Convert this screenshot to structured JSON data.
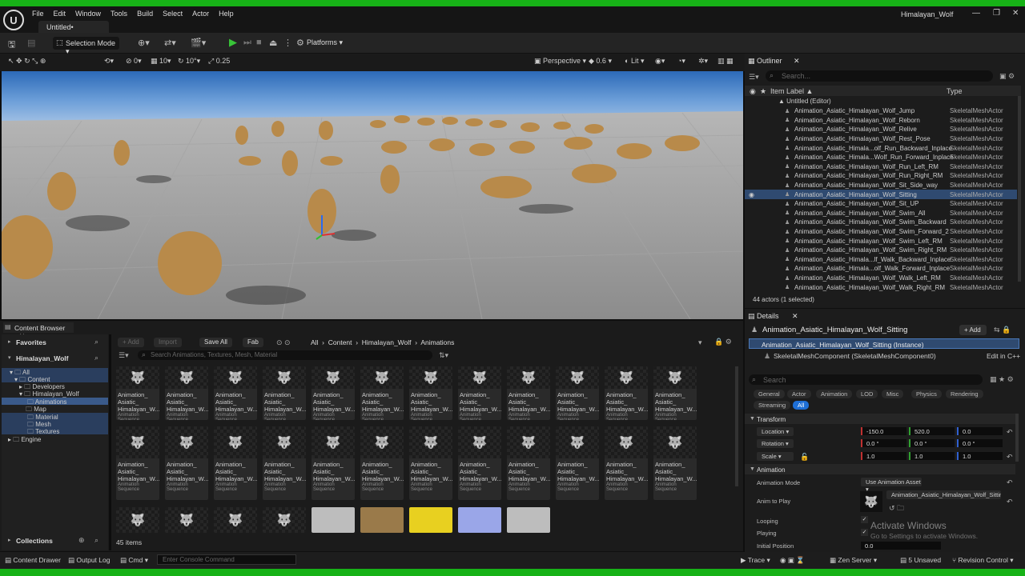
{
  "menu": [
    "File",
    "Edit",
    "Window",
    "Tools",
    "Build",
    "Select",
    "Actor",
    "Help"
  ],
  "document_tab": "Untitled•",
  "window_title": "Himalayan_Wolf",
  "toolbar": {
    "selection_mode": "Selection Mode",
    "platforms": "Platforms"
  },
  "viewport_bar": {
    "snap_translate": "0",
    "snap_grid": "10",
    "snap_rotate": "10°",
    "snap_scale": "0.25",
    "view_mode": "Perspective",
    "fov": "0.6",
    "lit": "Lit"
  },
  "outliner": {
    "tab": "Outliner",
    "search_placeholder": "Search...",
    "col_label": "Item Label ▲",
    "col_type": "Type",
    "root": "Untitled (Editor)",
    "rows": [
      {
        "label": "Animation_Asiatic_Himalayan_Wolf_Jump",
        "type": "SkeletalMeshActor"
      },
      {
        "label": "Animation_Asiatic_Himalayan_Wolf_Reborn",
        "type": "SkeletalMeshActor"
      },
      {
        "label": "Animation_Asiatic_Himalayan_Wolf_Relive",
        "type": "SkeletalMeshActor"
      },
      {
        "label": "Animation_Asiatic_Himalayan_Wolf_Rest_Pose",
        "type": "SkeletalMeshActor"
      },
      {
        "label": "Animation_Asiatic_Himala...olf_Run_Backward_Inplace",
        "type": "SkeletalMeshActor"
      },
      {
        "label": "Animation_Asiatic_Himala...Wolf_Run_Forward_Inplace",
        "type": "SkeletalMeshActor"
      },
      {
        "label": "Animation_Asiatic_Himalayan_Wolf_Run_Left_RM",
        "type": "SkeletalMeshActor"
      },
      {
        "label": "Animation_Asiatic_Himalayan_Wolf_Run_Right_RM",
        "type": "SkeletalMeshActor"
      },
      {
        "label": "Animation_Asiatic_Himalayan_Wolf_Sit_Side_way",
        "type": "SkeletalMeshActor"
      },
      {
        "label": "Animation_Asiatic_Himalayan_Wolf_Sitting",
        "type": "SkeletalMeshActor"
      },
      {
        "label": "Animation_Asiatic_Himalayan_Wolf_Sit_UP",
        "type": "SkeletalMeshActor"
      },
      {
        "label": "Animation_Asiatic_Himalayan_Wolf_Swim_All",
        "type": "SkeletalMeshActor"
      },
      {
        "label": "Animation_Asiatic_Himalayan_Wolf_Swim_Backward",
        "type": "SkeletalMeshActor"
      },
      {
        "label": "Animation_Asiatic_Himalayan_Wolf_Swim_Forward_2",
        "type": "SkeletalMeshActor"
      },
      {
        "label": "Animation_Asiatic_Himalayan_Wolf_Swim_Left_RM",
        "type": "SkeletalMeshActor"
      },
      {
        "label": "Animation_Asiatic_Himalayan_Wolf_Swim_Right_RM",
        "type": "SkeletalMeshActor"
      },
      {
        "label": "Animation_Asiatic_Himala...lf_Walk_Backward_Inplace",
        "type": "SkeletalMeshActor"
      },
      {
        "label": "Animation_Asiatic_Himala...olf_Walk_Forward_Inplace",
        "type": "SkeletalMeshActor"
      },
      {
        "label": "Animation_Asiatic_Himalayan_Wolf_Walk_Left_RM",
        "type": "SkeletalMeshActor"
      },
      {
        "label": "Animation_Asiatic_Himalayan_Wolf_Walk_Right_RM",
        "type": "SkeletalMeshActor"
      }
    ],
    "selected_index": 9,
    "count": "44 actors (1 selected)"
  },
  "details": {
    "tab": "Details",
    "actor": "Animation_Asiatic_Himalayan_Wolf_Sitting",
    "add": "+ Add",
    "instance": "Animation_Asiatic_Himalayan_Wolf_Sitting (Instance)",
    "component": "SkeletalMeshComponent (SkeletalMeshComponent0)",
    "edit_cpp": "Edit in C++",
    "search_placeholder": "Search",
    "filters": [
      "General",
      "Actor",
      "Animation",
      "LOD",
      "Misc",
      "Physics",
      "Rendering",
      "Streaming",
      "All"
    ],
    "transform_header": "Transform",
    "location_label": "Location",
    "location": [
      "-150.0",
      "520.0",
      "0.0"
    ],
    "rotation_label": "Rotation",
    "rotation": [
      "0.0 °",
      "0.0 °",
      "0.0 °"
    ],
    "scale_label": "Scale",
    "scale": [
      "1.0",
      "1.0",
      "1.0"
    ],
    "animation_header": "Animation",
    "anim_mode_label": "Animation Mode",
    "anim_mode": "Use Animation Asset",
    "anim_to_play_label": "Anim to Play",
    "anim_to_play": "Animation_Asiatic_Himalayan_Wolf_Sitting",
    "looping_label": "Looping",
    "playing_label": "Playing",
    "initial_pos_label": "Initial Position",
    "initial_pos": "0.0"
  },
  "watermark": {
    "line1": "Activate Windows",
    "line2": "Go to Settings to activate Windows."
  },
  "content_browser": {
    "tab": "Content Browser",
    "favorites": "Favorites",
    "project": "Himalayan_Wolf",
    "tree": [
      "All",
      "Content",
      "Developers",
      "Himalayan_Wolf",
      "Animations",
      "Map",
      "Material",
      "Mesh",
      "Textures",
      "Engine"
    ],
    "collections": "Collections",
    "buttons": {
      "add": "+ Add",
      "import": "Import",
      "save_all": "Save All",
      "fab": "Fab"
    },
    "crumbs": [
      "All",
      "Content",
      "Himalayan_Wolf",
      "Animations"
    ],
    "search_placeholder": "Search Animations, Textures, Mesh, Material",
    "tile_name": [
      "Animation_",
      "Asiatic_",
      "Himalayan_W..."
    ],
    "tile_type": "Animation Sequence",
    "items_count": "45 items"
  },
  "statusbar": {
    "content_drawer": "Content Drawer",
    "output_log": "Output Log",
    "cmd": "Cmd",
    "console_placeholder": "Enter Console Command",
    "trace": "Trace",
    "zen": "Zen Server",
    "unsaved": "5 Unsaved",
    "revision": "Revision Control"
  },
  "colors": {
    "accent_green": "#17b217",
    "selection_blue": "#2f4a70",
    "filter_blue": "#1e6fd6"
  }
}
